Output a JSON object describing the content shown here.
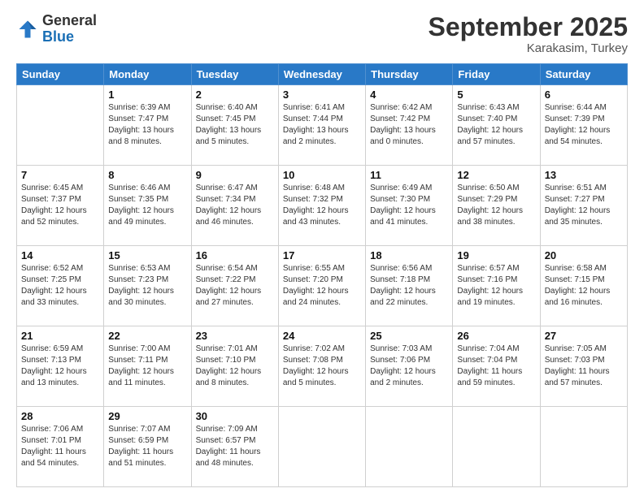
{
  "logo": {
    "general": "General",
    "blue": "Blue"
  },
  "header": {
    "month": "September 2025",
    "location": "Karakasim, Turkey"
  },
  "days_of_week": [
    "Sunday",
    "Monday",
    "Tuesday",
    "Wednesday",
    "Thursday",
    "Friday",
    "Saturday"
  ],
  "weeks": [
    [
      {
        "day": "",
        "sunrise": "",
        "sunset": "",
        "daylight": ""
      },
      {
        "day": "1",
        "sunrise": "Sunrise: 6:39 AM",
        "sunset": "Sunset: 7:47 PM",
        "daylight": "Daylight: 13 hours and 8 minutes."
      },
      {
        "day": "2",
        "sunrise": "Sunrise: 6:40 AM",
        "sunset": "Sunset: 7:45 PM",
        "daylight": "Daylight: 13 hours and 5 minutes."
      },
      {
        "day": "3",
        "sunrise": "Sunrise: 6:41 AM",
        "sunset": "Sunset: 7:44 PM",
        "daylight": "Daylight: 13 hours and 2 minutes."
      },
      {
        "day": "4",
        "sunrise": "Sunrise: 6:42 AM",
        "sunset": "Sunset: 7:42 PM",
        "daylight": "Daylight: 13 hours and 0 minutes."
      },
      {
        "day": "5",
        "sunrise": "Sunrise: 6:43 AM",
        "sunset": "Sunset: 7:40 PM",
        "daylight": "Daylight: 12 hours and 57 minutes."
      },
      {
        "day": "6",
        "sunrise": "Sunrise: 6:44 AM",
        "sunset": "Sunset: 7:39 PM",
        "daylight": "Daylight: 12 hours and 54 minutes."
      }
    ],
    [
      {
        "day": "7",
        "sunrise": "Sunrise: 6:45 AM",
        "sunset": "Sunset: 7:37 PM",
        "daylight": "Daylight: 12 hours and 52 minutes."
      },
      {
        "day": "8",
        "sunrise": "Sunrise: 6:46 AM",
        "sunset": "Sunset: 7:35 PM",
        "daylight": "Daylight: 12 hours and 49 minutes."
      },
      {
        "day": "9",
        "sunrise": "Sunrise: 6:47 AM",
        "sunset": "Sunset: 7:34 PM",
        "daylight": "Daylight: 12 hours and 46 minutes."
      },
      {
        "day": "10",
        "sunrise": "Sunrise: 6:48 AM",
        "sunset": "Sunset: 7:32 PM",
        "daylight": "Daylight: 12 hours and 43 minutes."
      },
      {
        "day": "11",
        "sunrise": "Sunrise: 6:49 AM",
        "sunset": "Sunset: 7:30 PM",
        "daylight": "Daylight: 12 hours and 41 minutes."
      },
      {
        "day": "12",
        "sunrise": "Sunrise: 6:50 AM",
        "sunset": "Sunset: 7:29 PM",
        "daylight": "Daylight: 12 hours and 38 minutes."
      },
      {
        "day": "13",
        "sunrise": "Sunrise: 6:51 AM",
        "sunset": "Sunset: 7:27 PM",
        "daylight": "Daylight: 12 hours and 35 minutes."
      }
    ],
    [
      {
        "day": "14",
        "sunrise": "Sunrise: 6:52 AM",
        "sunset": "Sunset: 7:25 PM",
        "daylight": "Daylight: 12 hours and 33 minutes."
      },
      {
        "day": "15",
        "sunrise": "Sunrise: 6:53 AM",
        "sunset": "Sunset: 7:23 PM",
        "daylight": "Daylight: 12 hours and 30 minutes."
      },
      {
        "day": "16",
        "sunrise": "Sunrise: 6:54 AM",
        "sunset": "Sunset: 7:22 PM",
        "daylight": "Daylight: 12 hours and 27 minutes."
      },
      {
        "day": "17",
        "sunrise": "Sunrise: 6:55 AM",
        "sunset": "Sunset: 7:20 PM",
        "daylight": "Daylight: 12 hours and 24 minutes."
      },
      {
        "day": "18",
        "sunrise": "Sunrise: 6:56 AM",
        "sunset": "Sunset: 7:18 PM",
        "daylight": "Daylight: 12 hours and 22 minutes."
      },
      {
        "day": "19",
        "sunrise": "Sunrise: 6:57 AM",
        "sunset": "Sunset: 7:16 PM",
        "daylight": "Daylight: 12 hours and 19 minutes."
      },
      {
        "day": "20",
        "sunrise": "Sunrise: 6:58 AM",
        "sunset": "Sunset: 7:15 PM",
        "daylight": "Daylight: 12 hours and 16 minutes."
      }
    ],
    [
      {
        "day": "21",
        "sunrise": "Sunrise: 6:59 AM",
        "sunset": "Sunset: 7:13 PM",
        "daylight": "Daylight: 12 hours and 13 minutes."
      },
      {
        "day": "22",
        "sunrise": "Sunrise: 7:00 AM",
        "sunset": "Sunset: 7:11 PM",
        "daylight": "Daylight: 12 hours and 11 minutes."
      },
      {
        "day": "23",
        "sunrise": "Sunrise: 7:01 AM",
        "sunset": "Sunset: 7:10 PM",
        "daylight": "Daylight: 12 hours and 8 minutes."
      },
      {
        "day": "24",
        "sunrise": "Sunrise: 7:02 AM",
        "sunset": "Sunset: 7:08 PM",
        "daylight": "Daylight: 12 hours and 5 minutes."
      },
      {
        "day": "25",
        "sunrise": "Sunrise: 7:03 AM",
        "sunset": "Sunset: 7:06 PM",
        "daylight": "Daylight: 12 hours and 2 minutes."
      },
      {
        "day": "26",
        "sunrise": "Sunrise: 7:04 AM",
        "sunset": "Sunset: 7:04 PM",
        "daylight": "Daylight: 11 hours and 59 minutes."
      },
      {
        "day": "27",
        "sunrise": "Sunrise: 7:05 AM",
        "sunset": "Sunset: 7:03 PM",
        "daylight": "Daylight: 11 hours and 57 minutes."
      }
    ],
    [
      {
        "day": "28",
        "sunrise": "Sunrise: 7:06 AM",
        "sunset": "Sunset: 7:01 PM",
        "daylight": "Daylight: 11 hours and 54 minutes."
      },
      {
        "day": "29",
        "sunrise": "Sunrise: 7:07 AM",
        "sunset": "Sunset: 6:59 PM",
        "daylight": "Daylight: 11 hours and 51 minutes."
      },
      {
        "day": "30",
        "sunrise": "Sunrise: 7:09 AM",
        "sunset": "Sunset: 6:57 PM",
        "daylight": "Daylight: 11 hours and 48 minutes."
      },
      {
        "day": "",
        "sunrise": "",
        "sunset": "",
        "daylight": ""
      },
      {
        "day": "",
        "sunrise": "",
        "sunset": "",
        "daylight": ""
      },
      {
        "day": "",
        "sunrise": "",
        "sunset": "",
        "daylight": ""
      },
      {
        "day": "",
        "sunrise": "",
        "sunset": "",
        "daylight": ""
      }
    ]
  ]
}
